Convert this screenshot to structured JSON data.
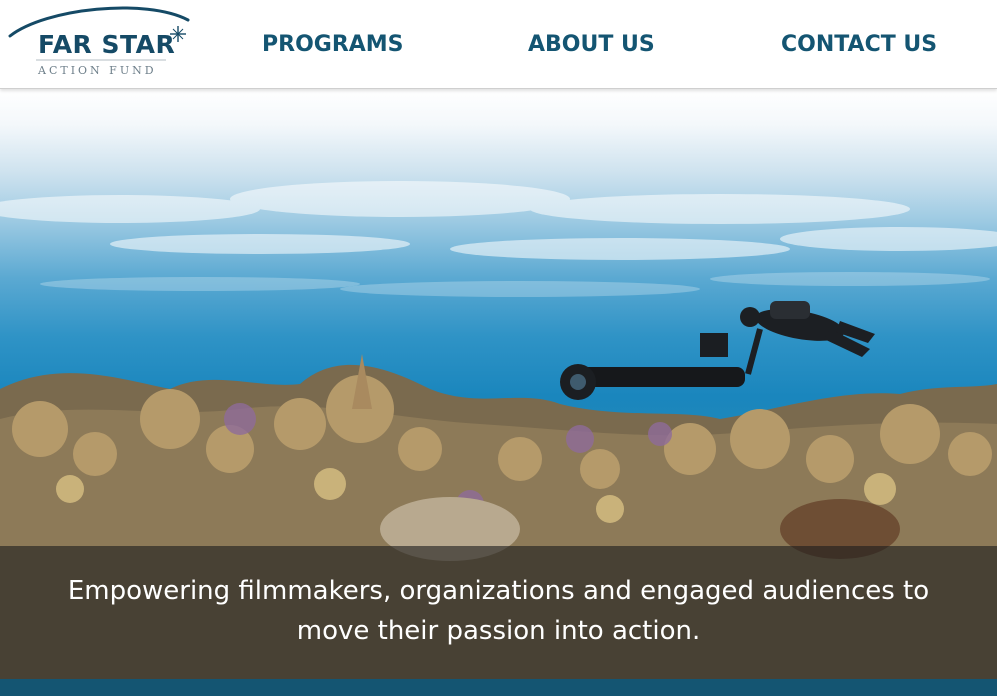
{
  "logo": {
    "name": "FAR STAR",
    "subtitle": "ACTION FUND",
    "icon": "star-burst-icon"
  },
  "nav": {
    "items": [
      {
        "label": "PROGRAMS"
      },
      {
        "label": "ABOUT US"
      },
      {
        "label": "CONTACT US"
      }
    ]
  },
  "hero": {
    "image": "underwater-coral-reef-diver-with-camera",
    "caption": "Empowering filmmakers, organizations and engaged audiences to move their passion into action."
  },
  "colors": {
    "brand": "#145572",
    "nav_text": "#145572",
    "caption_text": "#ffffff"
  }
}
